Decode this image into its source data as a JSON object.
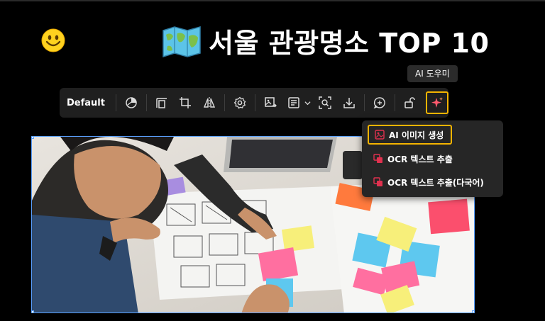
{
  "slide": {
    "title": "서울 관광명소 TOP 10",
    "emoji_left": "smiley-face-icon",
    "emoji_title": "world-map-icon"
  },
  "toolbar": {
    "preset_label": "Default",
    "buttons": [
      "style-icon",
      "align-icon",
      "crop-icon",
      "flip-icon",
      "settings-icon",
      "replace-image-icon",
      "alt-text-icon",
      "zoom-icon",
      "download-icon",
      "comment-icon",
      "lock-icon",
      "ai-sparkle-icon"
    ],
    "ai_tooltip": "AI 도우미"
  },
  "ai_menu": {
    "items": [
      {
        "label": "AI 이미지 생성",
        "icon": "image-generate-icon"
      },
      {
        "label": "OCR 텍스트 추출",
        "icon": "ocr-icon"
      },
      {
        "label": "OCR 텍스트 추출(다국어)",
        "icon": "ocr-multilang-icon"
      }
    ]
  },
  "colors": {
    "accent_highlight": "#f5b400",
    "selection_border": "#5aa0ff",
    "icon_red": "#e0314f"
  }
}
